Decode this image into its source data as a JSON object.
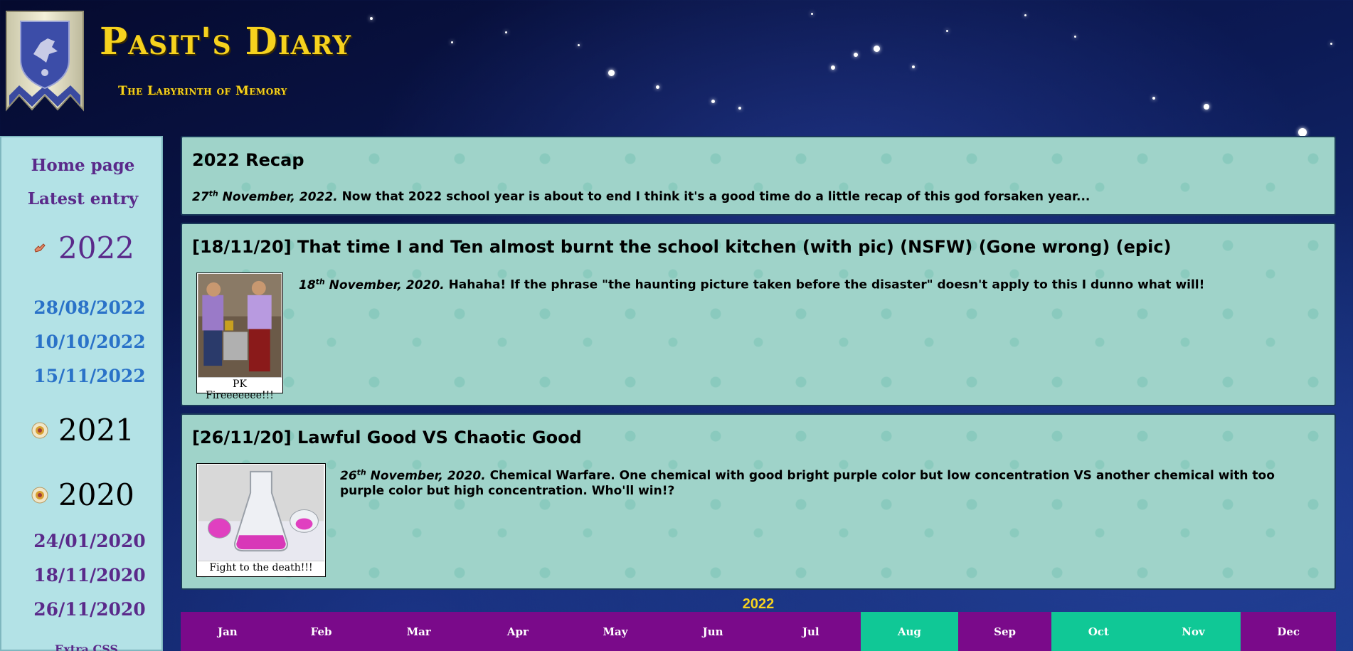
{
  "header": {
    "site_title": "Pasit's Diary",
    "site_subtitle": "The Labyrinth of Memory"
  },
  "sidebar": {
    "home_link": "Home page",
    "latest_link": "Latest entry",
    "years": [
      {
        "year": "2022",
        "icon": "pointing-hand-icon",
        "color": "#5a2a8a",
        "dates": [
          "28/08/2022",
          "10/10/2022",
          "15/11/2022"
        ],
        "date_color": "#2a72c8"
      },
      {
        "year": "2021",
        "icon": "seal-icon",
        "color": "#000000",
        "dates": []
      },
      {
        "year": "2020",
        "icon": "seal-icon",
        "color": "#000000",
        "dates": [
          "24/01/2020",
          "18/11/2020",
          "26/11/2020"
        ],
        "date_color": "#5a2a8a"
      }
    ],
    "extra_link": "Extra CSS"
  },
  "entries": [
    {
      "title": "2022 Recap",
      "date_day": "27",
      "date_suffix": "th",
      "date_rest": " November, 2022.",
      "text": " Now that 2022 school year is about to end I think it's a good time do a little recap of this god forsaken year..."
    },
    {
      "title": "[18/11/20] That time I and Ten almost burnt the school kitchen (with pic) (NSFW) (Gone wrong) (epic)",
      "date_day": "18",
      "date_suffix": "th",
      "date_rest": " November, 2020.",
      "text": " Hahaha! If the phrase \"the haunting picture taken before the disaster\" doesn't apply to this I dunno what will!",
      "image_caption": "PK Fireeeeeee!!!"
    },
    {
      "title": "[26/11/20] Lawful Good VS Chaotic Good",
      "date_day": "26",
      "date_suffix": "th",
      "date_rest": " November, 2020.",
      "text": " Chemical Warfare. One chemical with good bright purple color but low concentration VS another chemical with too purple color but high concentration. Who'll win!?",
      "image_caption": "Fight to the death!!!"
    }
  ],
  "calendar": {
    "year": "2022",
    "months": [
      {
        "label": "Jan",
        "color": "#7a0a8a"
      },
      {
        "label": "Feb",
        "color": "#7a0a8a"
      },
      {
        "label": "Mar",
        "color": "#7a0a8a"
      },
      {
        "label": "Apr",
        "color": "#7a0a8a"
      },
      {
        "label": "May",
        "color": "#7a0a8a"
      },
      {
        "label": "Jun",
        "color": "#7a0a8a"
      },
      {
        "label": "Jul",
        "color": "#7a0a8a"
      },
      {
        "label": "Aug",
        "color": "#10c896"
      },
      {
        "label": "Sep",
        "color": "#7a0a8a"
      },
      {
        "label": "Oct",
        "color": "#10c896"
      },
      {
        "label": "Nov",
        "color": "#10c896"
      },
      {
        "label": "Dec",
        "color": "#7a0a8a"
      }
    ]
  },
  "colors": {
    "accent_gold": "#f6d21e",
    "sidebar_bg": "#b3e2e6",
    "entry_bg": "#9fd3c9"
  }
}
